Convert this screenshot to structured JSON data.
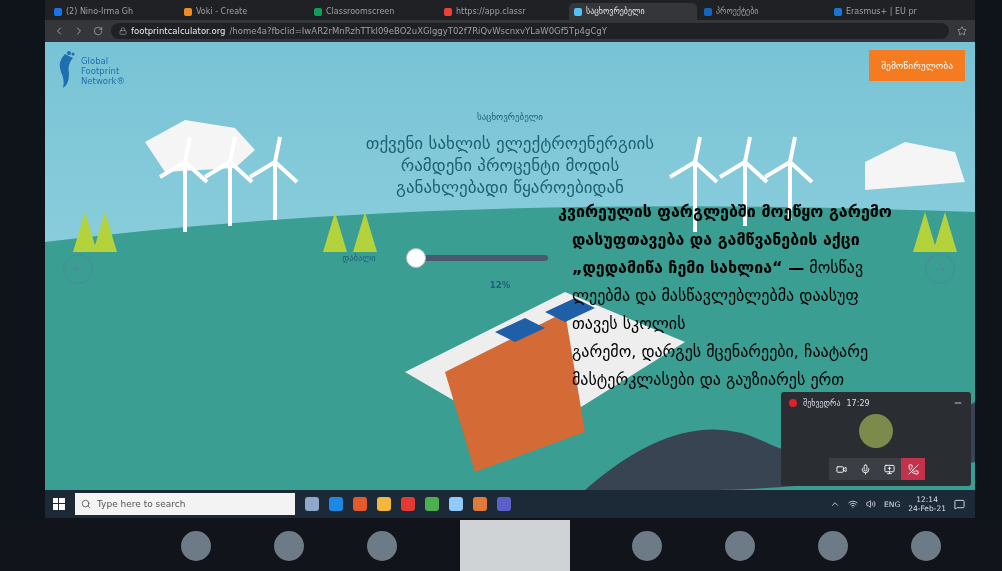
{
  "browser": {
    "tabs": [
      {
        "label": "(2) Nino-Irma Gh",
        "selected": false
      },
      {
        "label": "Voki - Create",
        "selected": false
      },
      {
        "label": "Classroomscreen",
        "selected": false
      },
      {
        "label": "https://app.classr",
        "selected": false
      },
      {
        "label": "საცხოვრებელი",
        "selected": true
      },
      {
        "label": "პროექტები",
        "selected": false
      },
      {
        "label": "Erasmus+ | EU pr",
        "selected": false
      }
    ],
    "url_host": "footprintcalculator.org",
    "url_path": "/home4a?fbclid=IwAR2rMnRzhTTkl09eBO2uXGlggyT02f7RiQvWscnxvYLaW0Gf5Tp4gCgY"
  },
  "page": {
    "logo": [
      "Global",
      "Footprint",
      "Network®"
    ],
    "donate_button": "შემოწირულობა",
    "category": "საცხოვრებელი",
    "question": [
      "თქვენი სახლის ელექტროენერგიის",
      "რამდენი პროცენტი მოდის",
      "განახლებადი წყაროებიდან"
    ],
    "slider": {
      "label": "დაბალი",
      "level": 0.06,
      "reading": "12%"
    }
  },
  "caption": {
    "lines": [
      {
        "text": "კვირეულის ფარგლებში მოეწყო გარემო",
        "bold": true
      },
      {
        "text": "დასუფთავება და გამწვანების აქცი",
        "bold": true
      },
      {
        "text": "**„დედამიწა ჩემი სახლია“ —** მოსწავ",
        "bold": false
      },
      {
        "text": "ლეებმა და მასწავლებლებმა დაასუფ",
        "bold": false
      },
      {
        "text": "თავეს სკოლის",
        "bold": false
      },
      {
        "text": "გარემო, დარგეს მცენარეები, ჩაატარე",
        "bold": false
      },
      {
        "text": "მასტერკლასები და გაუზიარეს ერთ",
        "bold": false
      }
    ]
  },
  "meet_popup": {
    "title": "შეხვედრა",
    "time": "17:29",
    "recording": true
  },
  "taskbar": {
    "search_placeholder": "Type here to search",
    "language": "ENG",
    "time": "12:14",
    "date": "24-Feb-21"
  },
  "participants": [
    {
      "kind": "avatar"
    },
    {
      "kind": "avatar"
    },
    {
      "kind": "avatar"
    },
    {
      "kind": "video"
    },
    {
      "kind": "avatar"
    },
    {
      "kind": "avatar"
    },
    {
      "kind": "avatar"
    },
    {
      "kind": "avatar"
    }
  ]
}
